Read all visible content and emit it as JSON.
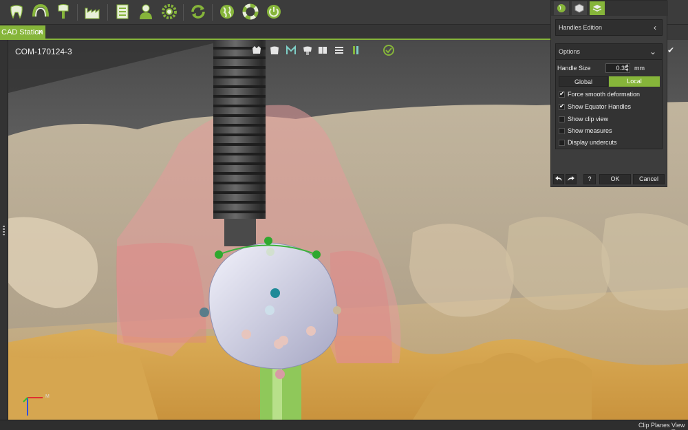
{
  "toolbar": {
    "icons": [
      "tooth-icon",
      "dental-arch-icon",
      "implant-icon",
      "factory-icon",
      "checklist-icon",
      "user-icon",
      "gear-icon",
      "refresh-icon",
      "globe-icon",
      "lifebuoy-icon",
      "power-icon"
    ]
  },
  "tab": {
    "label": "CAD Station",
    "close": "✕"
  },
  "viewport": {
    "case_id": "COM-170124-3",
    "axis_x": "M"
  },
  "panel": {
    "header": "Handles Edition",
    "options": {
      "title": "Options",
      "handle_size_label": "Handle Size",
      "handle_size_value": "0.35",
      "handle_size_unit": "mm",
      "mode_global": "Global",
      "mode_local": "Local",
      "mode_selected": "Local",
      "checkboxes": [
        {
          "label": "Force smooth deformation",
          "checked": true
        },
        {
          "label": "Show Equator Handles",
          "checked": true
        },
        {
          "label": "Show clip view",
          "checked": false
        },
        {
          "label": "Show measures",
          "checked": false
        },
        {
          "label": "Display undercuts",
          "checked": false
        }
      ]
    },
    "buttons": {
      "ok": "OK",
      "cancel": "Cancel",
      "help": "?"
    }
  },
  "status": {
    "clip_planes": "Clip Planes",
    "view": "View T"
  },
  "colors": {
    "accent": "#86b53a"
  }
}
